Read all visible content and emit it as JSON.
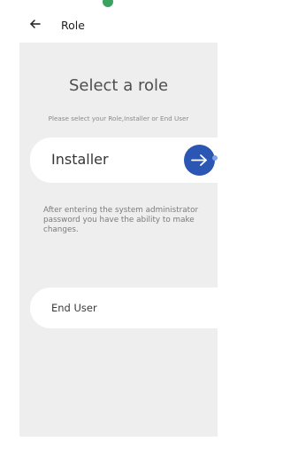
{
  "header": {
    "back_icon": "arrow-left-icon",
    "title": "Role"
  },
  "main": {
    "heading": "Select a role",
    "subheading": "Please select your Role,Installer or End User",
    "roles": [
      {
        "label": "Installer",
        "description": "After entering the system administrator password you have the ability to make changes.",
        "action_icon": "arrow-right-icon",
        "action_color": "#2c56b3"
      },
      {
        "label": "End User"
      }
    ]
  },
  "colors": {
    "background": "#eeeeee",
    "card": "#ffffff",
    "status_dot": "#3aa35f"
  }
}
